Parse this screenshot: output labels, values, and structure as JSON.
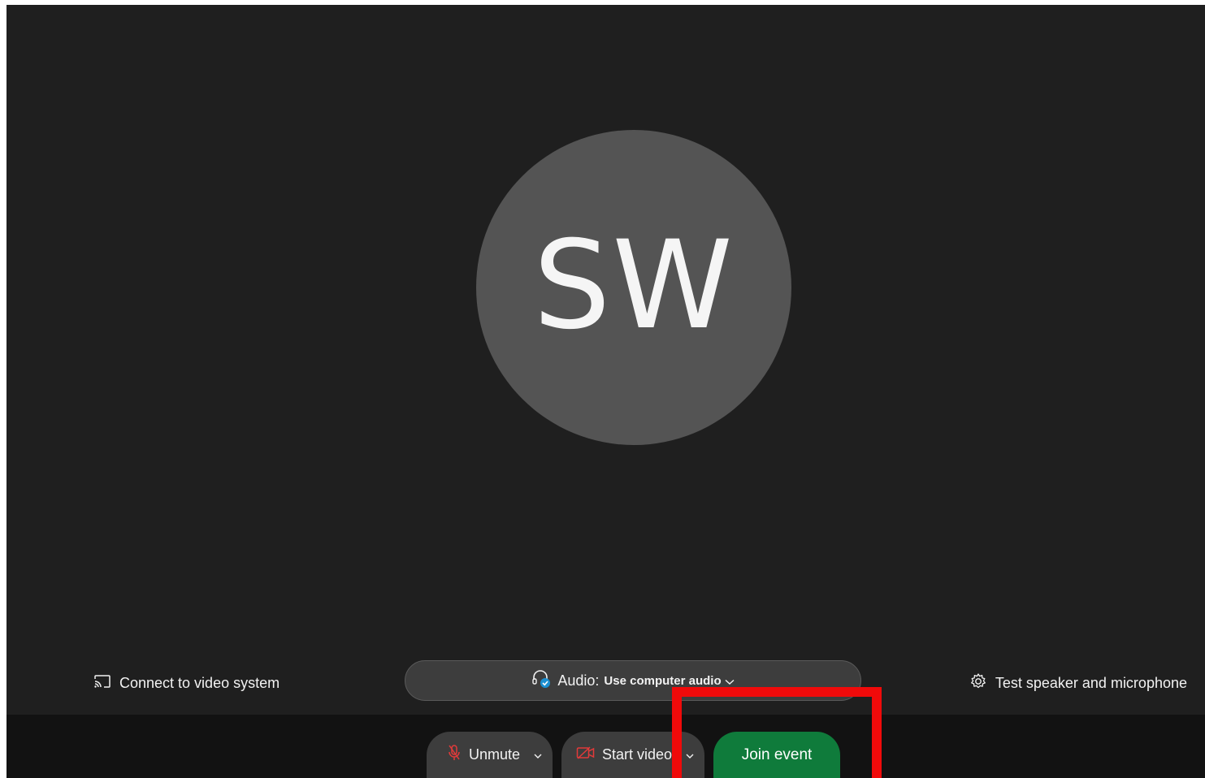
{
  "participant": {
    "initials": "SW",
    "avatar_color": "#545454"
  },
  "left_link": {
    "label": "Connect to video system",
    "icon": "cast-icon"
  },
  "audio": {
    "label": "Audio:",
    "value": "Use computer audio",
    "icon": "headset-check-icon"
  },
  "right_link": {
    "label": "Test speaker and microphone",
    "icon": "gear-icon"
  },
  "controls": {
    "unmute": {
      "label": "Unmute",
      "icon": "microphone-muted-icon"
    },
    "video": {
      "label": "Start video",
      "icon": "camera-off-icon"
    },
    "join": {
      "label": "Join event",
      "color": "#0f7b3b"
    }
  },
  "colors": {
    "background": "#1f1f1f",
    "footer": "#121212",
    "muted_icon": "#e23a3a",
    "highlight": "#f00a0a"
  }
}
